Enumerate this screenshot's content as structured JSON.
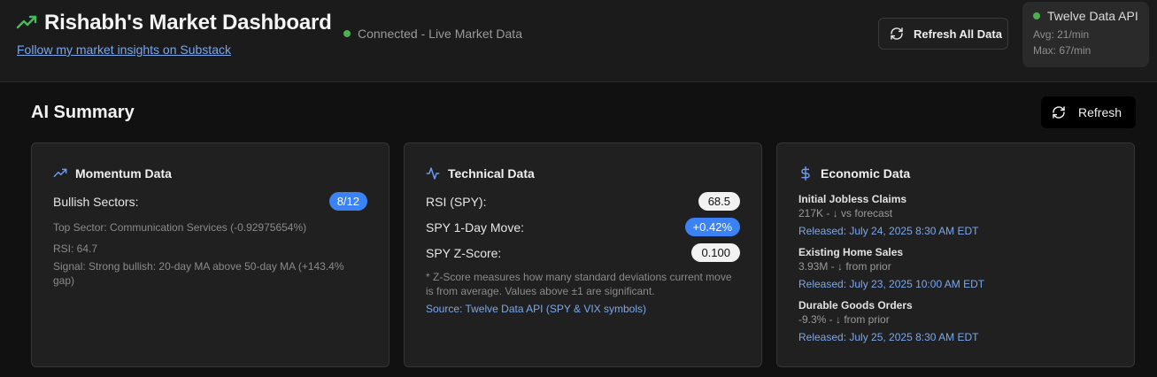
{
  "header": {
    "title": "Rishabh's Market Dashboard",
    "substack_link": "Follow my market insights on Substack",
    "status": "Connected - Live Market Data",
    "refresh_all_label": "Refresh All Data",
    "api": {
      "name": "Twelve Data API",
      "avg": "Avg: 21/min",
      "max": "Max: 67/min"
    }
  },
  "section": {
    "title": "AI Summary",
    "refresh_label": "Refresh"
  },
  "momentum": {
    "title": "Momentum Data",
    "bullish_label": "Bullish Sectors:",
    "bullish_value": "8/12",
    "top_sector": "Top Sector: Communication Services (-0.92975654%)",
    "rsi": "RSI: 64.7",
    "signal": "Signal: Strong bullish: 20-day MA above 50-day MA (+143.4% gap)"
  },
  "technical": {
    "title": "Technical Data",
    "rsi_label": "RSI (SPY):",
    "rsi_value": "68.5",
    "move_label": "SPY 1-Day Move:",
    "move_value": "+0.42%",
    "z_label": "SPY Z-Score:",
    "z_value": "0.100",
    "note": "* Z-Score measures how many standard deviations current move is from average. Values above ±1 are significant.",
    "source": "Source: Twelve Data API (SPY & VIX symbols)"
  },
  "economic": {
    "title": "Economic Data",
    "items": [
      {
        "name": "Initial Jobless Claims",
        "value": "217K - ↓ vs forecast",
        "released": "Released: July 24, 2025 8:30 AM EDT"
      },
      {
        "name": "Existing Home Sales",
        "value": "3.93M - ↓ from prior",
        "released": "Released: July 23, 2025 10:00 AM EDT"
      },
      {
        "name": "Durable Goods Orders",
        "value": "-9.3% - ↓ from prior",
        "released": "Released: July 25, 2025 8:30 AM EDT"
      }
    ]
  },
  "colors": {
    "accent_green": "#4caf50",
    "accent_blue": "#3b82f6",
    "link_blue": "#7aa7ee",
    "background": "#111111"
  },
  "icons": [
    "trending-up-icon",
    "refresh-icon",
    "activity-icon",
    "dollar-icon"
  ]
}
